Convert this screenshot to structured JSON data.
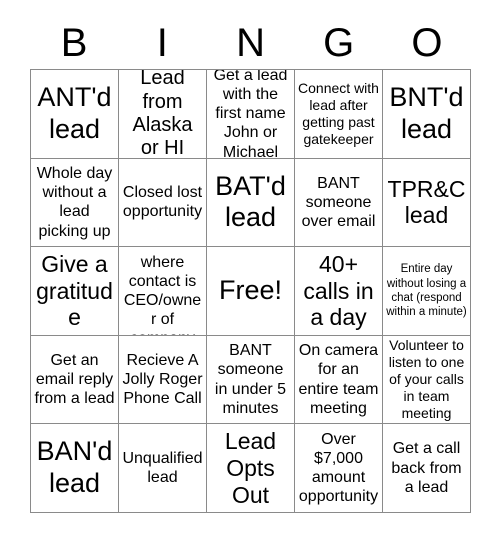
{
  "card": {
    "title": "BINGO",
    "headers": [
      "B",
      "I",
      "N",
      "G",
      "O"
    ],
    "grid_columns": 5,
    "grid_rows": 5,
    "text_color": "#000000",
    "background_color": "#ffffff",
    "border_color": "#8a8a8a",
    "cells": [
      {
        "id": "b1",
        "text": "ANT'd lead",
        "size": "xxl"
      },
      {
        "id": "i1",
        "text": "Lead from Alaska or HI",
        "size": "lg"
      },
      {
        "id": "n1",
        "text": "Get a lead with the first name John or Michael",
        "size": "md"
      },
      {
        "id": "g1",
        "text": "Connect with lead after getting past gatekeeper",
        "size": "sm"
      },
      {
        "id": "o1",
        "text": "BNT'd lead",
        "size": "xxl"
      },
      {
        "id": "b2",
        "text": "Whole day without a lead picking up",
        "size": "md"
      },
      {
        "id": "i2",
        "text": "Closed lost opportunity",
        "size": "md"
      },
      {
        "id": "n2",
        "text": "BAT'd lead",
        "size": "xxl"
      },
      {
        "id": "g2",
        "text": "BANT someone over email",
        "size": "md"
      },
      {
        "id": "o2",
        "text": "TPR&C lead",
        "size": "xl"
      },
      {
        "id": "b3",
        "text": "Give a gratitude",
        "size": "xl"
      },
      {
        "id": "i3",
        "text": "Lead where contact is CEO/owner of company",
        "size": "md"
      },
      {
        "id": "n3",
        "text": "Free!",
        "size": "xxl"
      },
      {
        "id": "g3",
        "text": "40+ calls in a day",
        "size": "xl"
      },
      {
        "id": "o3",
        "text": "Entire day without losing a chat (respond within a minute)",
        "size": "xs"
      },
      {
        "id": "b4",
        "text": "Get an email reply from a lead",
        "size": "md"
      },
      {
        "id": "i4",
        "text": "Recieve A Jolly Roger Phone Call",
        "size": "md"
      },
      {
        "id": "n4",
        "text": "BANT someone in under 5 minutes",
        "size": "md"
      },
      {
        "id": "g4",
        "text": "On camera for an entire team meeting",
        "size": "md"
      },
      {
        "id": "o4",
        "text": "Volunteer to listen to one of your calls in team meeting",
        "size": "sm"
      },
      {
        "id": "b5",
        "text": "BAN'd lead",
        "size": "xxl"
      },
      {
        "id": "i5",
        "text": "Unqualified lead",
        "size": "md"
      },
      {
        "id": "n5",
        "text": "Lead Opts Out",
        "size": "xl"
      },
      {
        "id": "g5",
        "text": "Over $7,000 amount opportunity",
        "size": "md"
      },
      {
        "id": "o5",
        "text": "Get a call back from a lead",
        "size": "md"
      }
    ]
  }
}
